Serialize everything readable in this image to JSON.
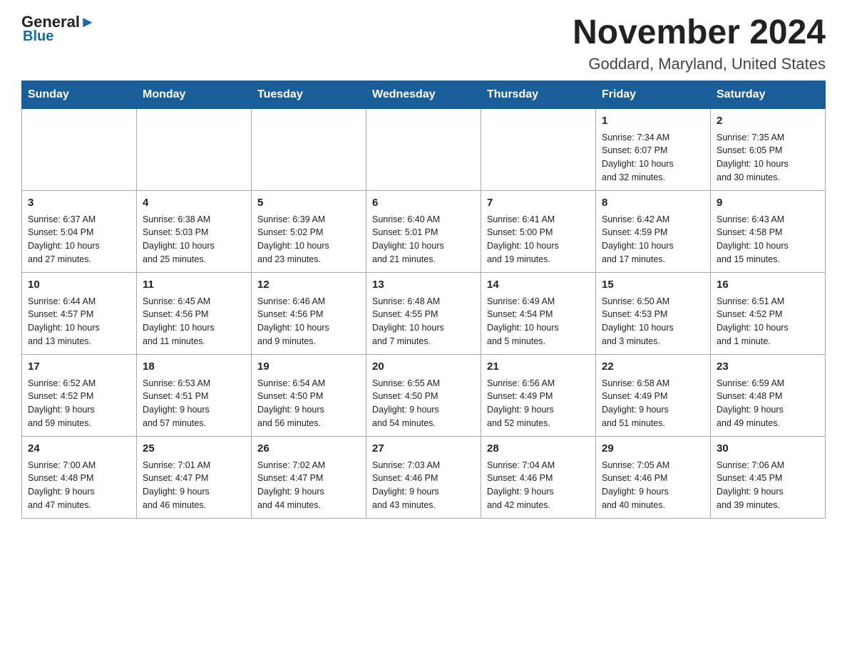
{
  "logo": {
    "general": "General",
    "blue": "Blue",
    "arrow": "▶"
  },
  "header": {
    "month_title": "November 2024",
    "location": "Goddard, Maryland, United States"
  },
  "days_of_week": [
    "Sunday",
    "Monday",
    "Tuesday",
    "Wednesday",
    "Thursday",
    "Friday",
    "Saturday"
  ],
  "weeks": [
    [
      {
        "day": "",
        "info": ""
      },
      {
        "day": "",
        "info": ""
      },
      {
        "day": "",
        "info": ""
      },
      {
        "day": "",
        "info": ""
      },
      {
        "day": "",
        "info": ""
      },
      {
        "day": "1",
        "info": "Sunrise: 7:34 AM\nSunset: 6:07 PM\nDaylight: 10 hours\nand 32 minutes."
      },
      {
        "day": "2",
        "info": "Sunrise: 7:35 AM\nSunset: 6:05 PM\nDaylight: 10 hours\nand 30 minutes."
      }
    ],
    [
      {
        "day": "3",
        "info": "Sunrise: 6:37 AM\nSunset: 5:04 PM\nDaylight: 10 hours\nand 27 minutes."
      },
      {
        "day": "4",
        "info": "Sunrise: 6:38 AM\nSunset: 5:03 PM\nDaylight: 10 hours\nand 25 minutes."
      },
      {
        "day": "5",
        "info": "Sunrise: 6:39 AM\nSunset: 5:02 PM\nDaylight: 10 hours\nand 23 minutes."
      },
      {
        "day": "6",
        "info": "Sunrise: 6:40 AM\nSunset: 5:01 PM\nDaylight: 10 hours\nand 21 minutes."
      },
      {
        "day": "7",
        "info": "Sunrise: 6:41 AM\nSunset: 5:00 PM\nDaylight: 10 hours\nand 19 minutes."
      },
      {
        "day": "8",
        "info": "Sunrise: 6:42 AM\nSunset: 4:59 PM\nDaylight: 10 hours\nand 17 minutes."
      },
      {
        "day": "9",
        "info": "Sunrise: 6:43 AM\nSunset: 4:58 PM\nDaylight: 10 hours\nand 15 minutes."
      }
    ],
    [
      {
        "day": "10",
        "info": "Sunrise: 6:44 AM\nSunset: 4:57 PM\nDaylight: 10 hours\nand 13 minutes."
      },
      {
        "day": "11",
        "info": "Sunrise: 6:45 AM\nSunset: 4:56 PM\nDaylight: 10 hours\nand 11 minutes."
      },
      {
        "day": "12",
        "info": "Sunrise: 6:46 AM\nSunset: 4:56 PM\nDaylight: 10 hours\nand 9 minutes."
      },
      {
        "day": "13",
        "info": "Sunrise: 6:48 AM\nSunset: 4:55 PM\nDaylight: 10 hours\nand 7 minutes."
      },
      {
        "day": "14",
        "info": "Sunrise: 6:49 AM\nSunset: 4:54 PM\nDaylight: 10 hours\nand 5 minutes."
      },
      {
        "day": "15",
        "info": "Sunrise: 6:50 AM\nSunset: 4:53 PM\nDaylight: 10 hours\nand 3 minutes."
      },
      {
        "day": "16",
        "info": "Sunrise: 6:51 AM\nSunset: 4:52 PM\nDaylight: 10 hours\nand 1 minute."
      }
    ],
    [
      {
        "day": "17",
        "info": "Sunrise: 6:52 AM\nSunset: 4:52 PM\nDaylight: 9 hours\nand 59 minutes."
      },
      {
        "day": "18",
        "info": "Sunrise: 6:53 AM\nSunset: 4:51 PM\nDaylight: 9 hours\nand 57 minutes."
      },
      {
        "day": "19",
        "info": "Sunrise: 6:54 AM\nSunset: 4:50 PM\nDaylight: 9 hours\nand 56 minutes."
      },
      {
        "day": "20",
        "info": "Sunrise: 6:55 AM\nSunset: 4:50 PM\nDaylight: 9 hours\nand 54 minutes."
      },
      {
        "day": "21",
        "info": "Sunrise: 6:56 AM\nSunset: 4:49 PM\nDaylight: 9 hours\nand 52 minutes."
      },
      {
        "day": "22",
        "info": "Sunrise: 6:58 AM\nSunset: 4:49 PM\nDaylight: 9 hours\nand 51 minutes."
      },
      {
        "day": "23",
        "info": "Sunrise: 6:59 AM\nSunset: 4:48 PM\nDaylight: 9 hours\nand 49 minutes."
      }
    ],
    [
      {
        "day": "24",
        "info": "Sunrise: 7:00 AM\nSunset: 4:48 PM\nDaylight: 9 hours\nand 47 minutes."
      },
      {
        "day": "25",
        "info": "Sunrise: 7:01 AM\nSunset: 4:47 PM\nDaylight: 9 hours\nand 46 minutes."
      },
      {
        "day": "26",
        "info": "Sunrise: 7:02 AM\nSunset: 4:47 PM\nDaylight: 9 hours\nand 44 minutes."
      },
      {
        "day": "27",
        "info": "Sunrise: 7:03 AM\nSunset: 4:46 PM\nDaylight: 9 hours\nand 43 minutes."
      },
      {
        "day": "28",
        "info": "Sunrise: 7:04 AM\nSunset: 4:46 PM\nDaylight: 9 hours\nand 42 minutes."
      },
      {
        "day": "29",
        "info": "Sunrise: 7:05 AM\nSunset: 4:46 PM\nDaylight: 9 hours\nand 40 minutes."
      },
      {
        "day": "30",
        "info": "Sunrise: 7:06 AM\nSunset: 4:45 PM\nDaylight: 9 hours\nand 39 minutes."
      }
    ]
  ]
}
